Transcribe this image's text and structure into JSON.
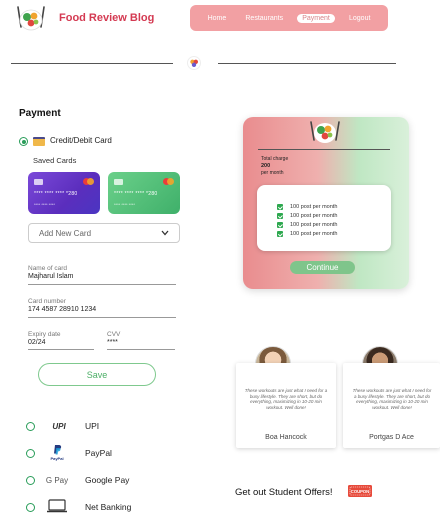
{
  "header": {
    "brand": "Food Review Blog",
    "nav": [
      "Home",
      "Restaurants",
      "Payment",
      "Logout"
    ],
    "active_nav": "Payment"
  },
  "payment": {
    "title": "Payment",
    "selected_method": "Credit/Debit Card",
    "credit_label": "Credit/Debit Card",
    "saved_label": "Saved Cards",
    "cards": [
      {
        "number": "**** **** **** *280",
        "sub": "**** ****   ****",
        "color": "#6a3fd0"
      },
      {
        "number": "**** **** **** *280",
        "sub": "**** ****   ****",
        "color": "#4cbf74"
      }
    ],
    "add_card_label": "Add New Card",
    "fields": {
      "name_label": "Name of card",
      "name_value": "Majharul Islam",
      "card_number_label": "Card number",
      "card_number_value": "174 4587 28910 1234",
      "expiry_label": "Expiry date",
      "expiry_value": "02/24",
      "cvv_label": "CVV",
      "cvv_value": "****"
    },
    "save_label": "Save",
    "other_methods": [
      {
        "icon": "upi-logo",
        "label": "UPI"
      },
      {
        "icon": "paypal-logo",
        "label": "PayPal"
      },
      {
        "icon": "google-pay-logo",
        "label": "Google Pay"
      },
      {
        "icon": "laptop-icon",
        "label": "Net Banking"
      }
    ],
    "upi_logo_text": "UPI",
    "paypal_logo_text": "PayPal",
    "gpay_logo_text": "G Pay"
  },
  "summary": {
    "charge_label": "Total charge",
    "charge_value": "200",
    "charge_period": "per month",
    "features": [
      "100 post per month",
      "100 post per month",
      "100 post per month",
      "100 post per month"
    ],
    "continue_label": "Continue"
  },
  "reviews": [
    {
      "quote": "These workouts are just what I need for a busy lifestyle. They are short, but do everything, maximizing in 10-20 min workout. Well done!",
      "name": "Boa Hancock"
    },
    {
      "quote": "These workouts are just what I need for a busy lifestyle. They are short, but do everything, maximizing in 10-20 min workout. Well done!",
      "name": "Portgas D Ace"
    }
  ],
  "offers": {
    "label": "Get out Student Offers!",
    "coupon_text": "COUPON"
  },
  "colors": {
    "brand": "#d43a52",
    "nav_bg": "#f2a0a3",
    "accent_green": "#4caf67",
    "card_purple": "#6a3fd0",
    "card_green": "#4cbf74"
  }
}
